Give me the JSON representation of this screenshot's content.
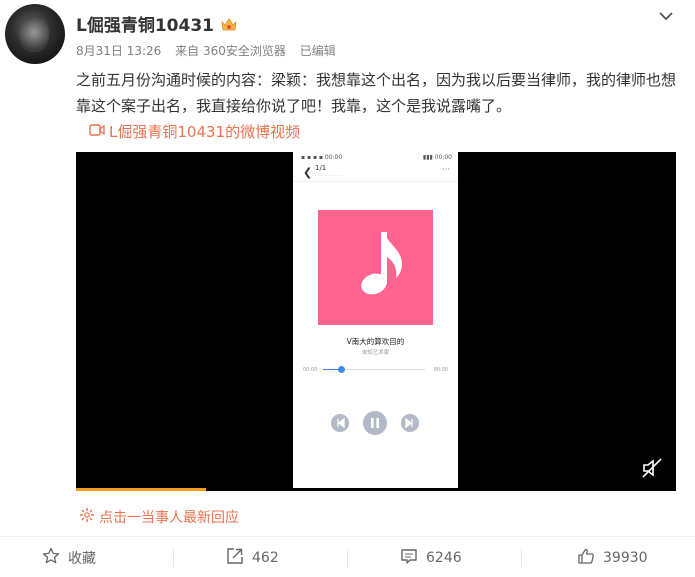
{
  "post": {
    "username": "L倔强青铜10431",
    "time": "8月31日 13:26",
    "source": "来自 360安全浏览器",
    "edited": "已编辑",
    "content": "之前五月份沟通时候的内容：梁颖：我想靠这个出名，因为我以后要当律师，我的律师也想靠这个案子出名，我直接给你说了吧！我靠，这个是我说露嘴了。",
    "video_link": "L倔强青铜10431的微博视频"
  },
  "video": {
    "progress": 0.217,
    "phone": {
      "page_indicator": "1/1",
      "song_title": "V南大的算欢目的",
      "artist": "未知艺术家",
      "time_start": "00:00",
      "time_end": "00:00",
      "playback_fraction": 0.18
    }
  },
  "hot_reply": "点击一当事人最新回应",
  "actions": {
    "favorite_label": "收藏",
    "repost_count": "462",
    "comment_count": "6246",
    "like_count": "39930"
  },
  "colors": {
    "accent": "#eb7350",
    "album": "#ff6491",
    "progress": "#f49c1d"
  }
}
